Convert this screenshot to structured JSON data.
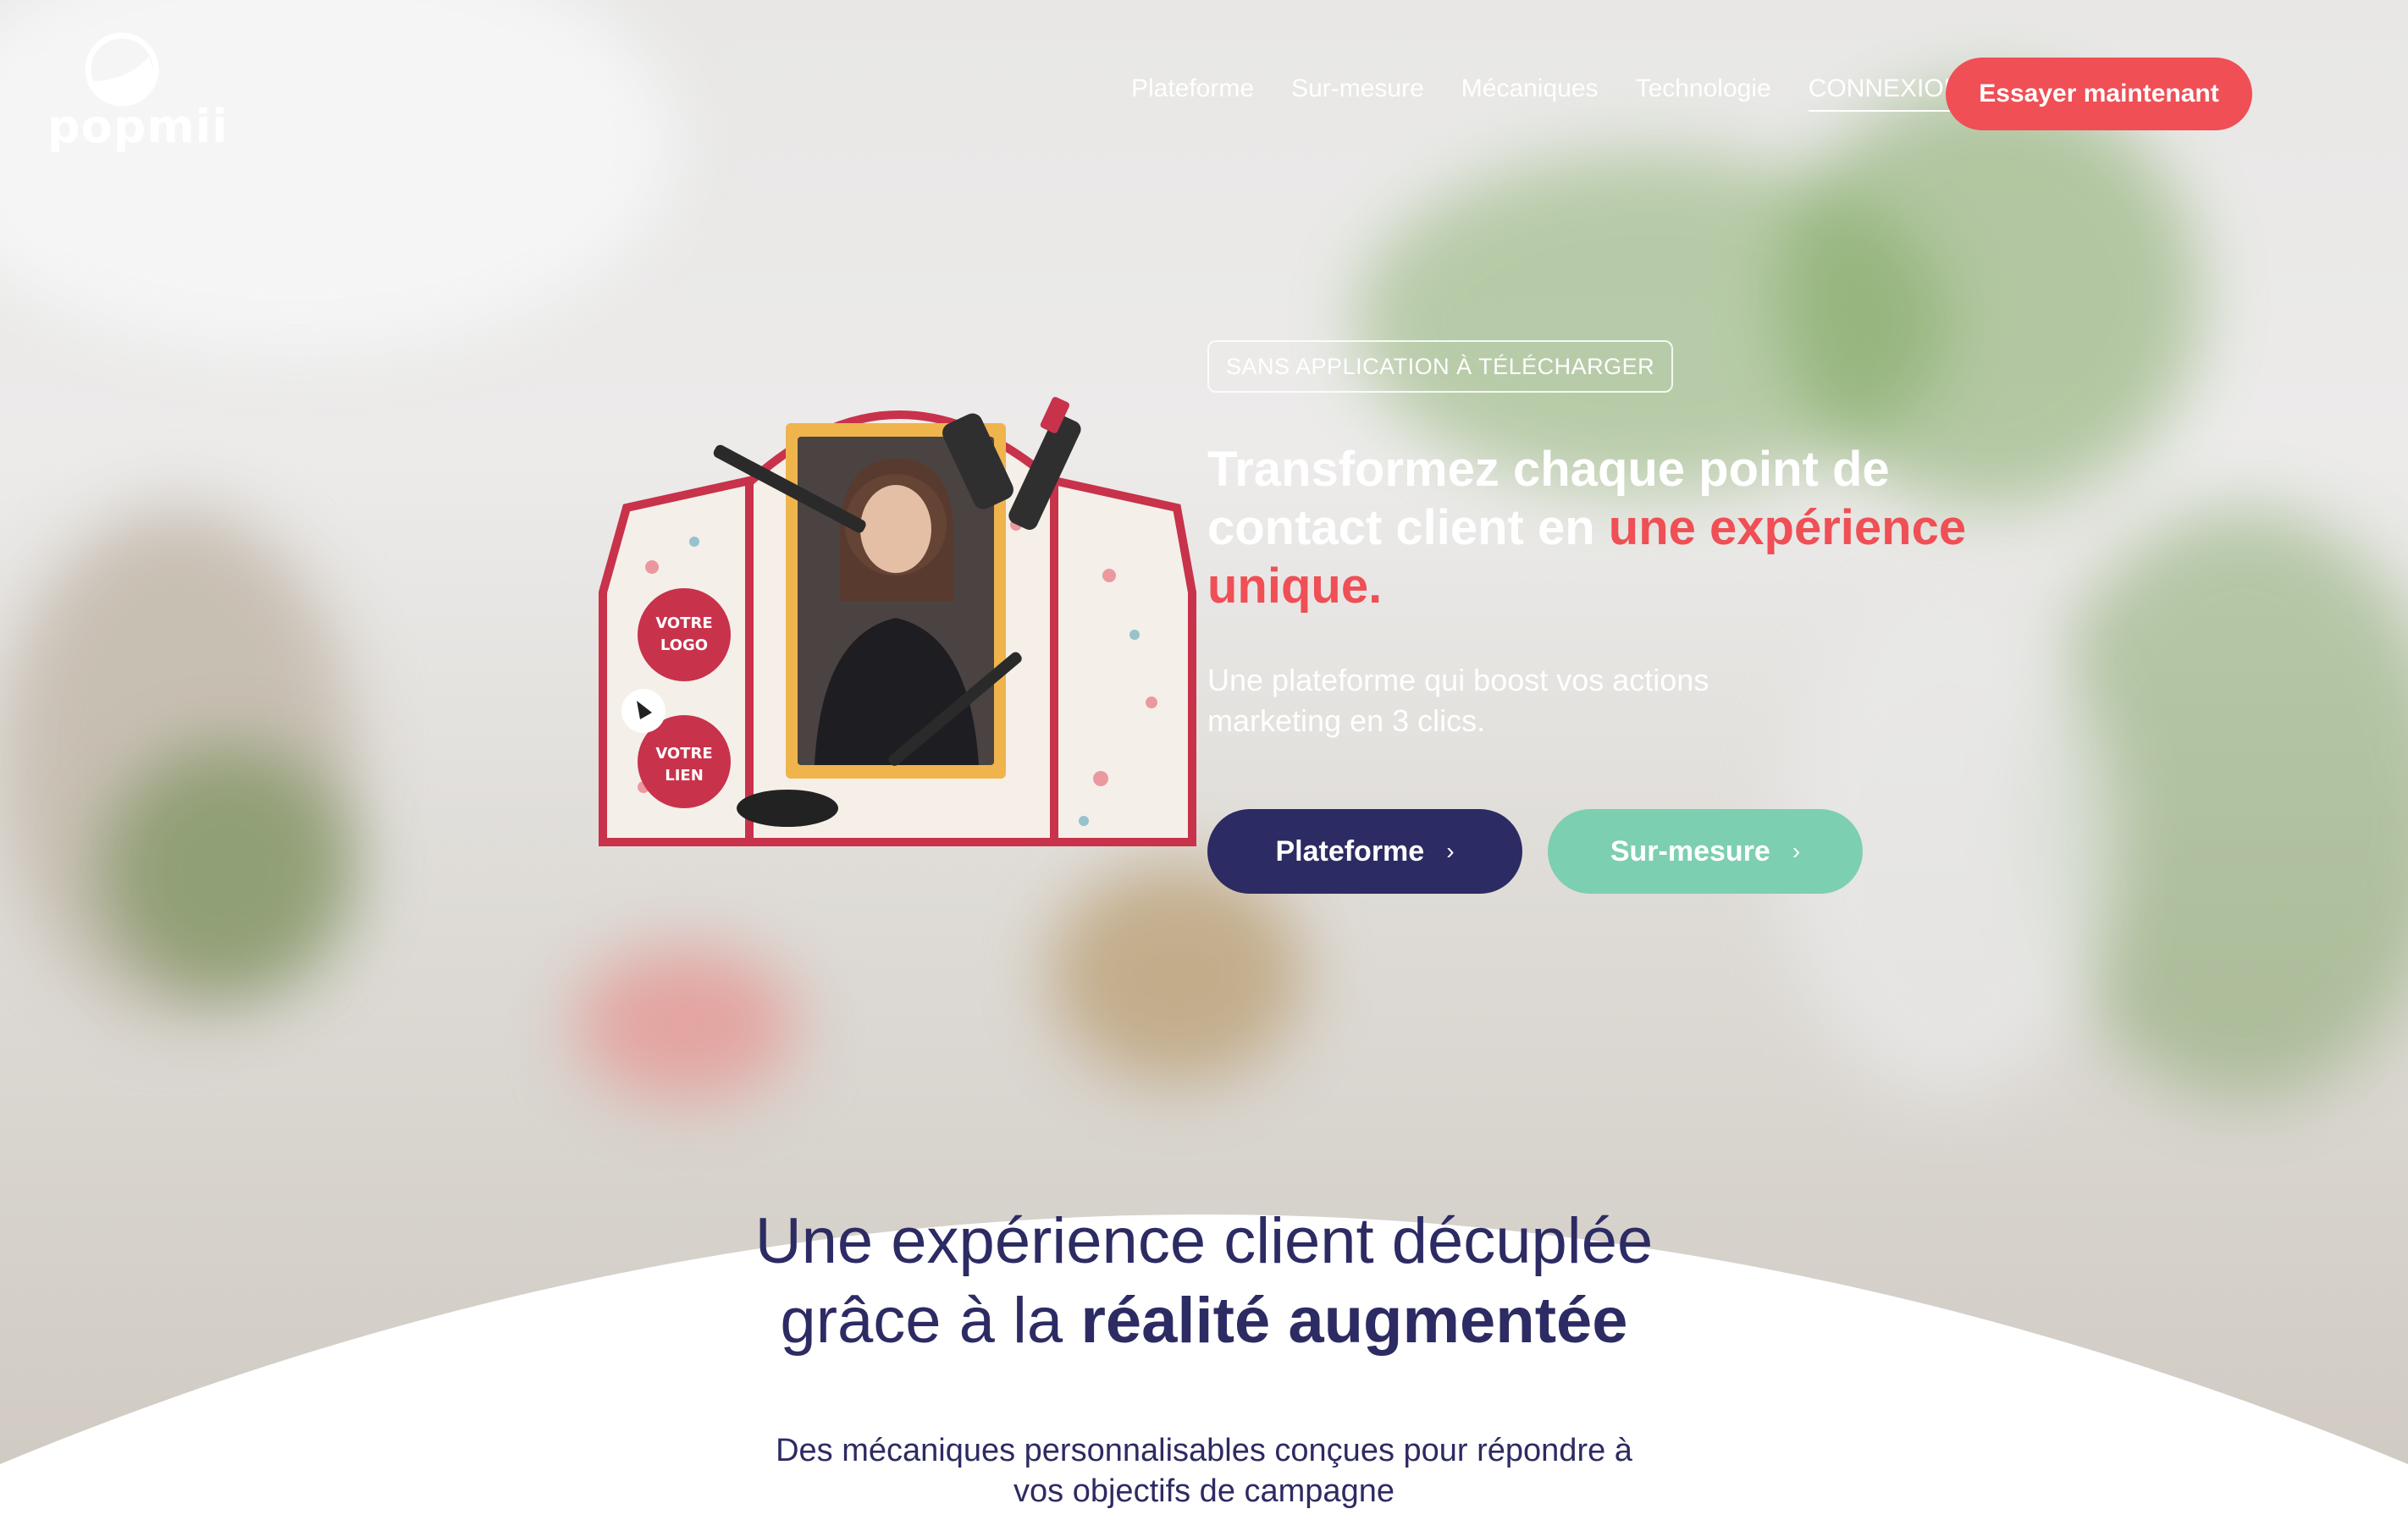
{
  "brand": {
    "name": "popmii"
  },
  "nav": {
    "items": [
      "Plateforme",
      "Sur-mesure",
      "Mécaniques",
      "Technologie"
    ],
    "login": "CONNEXION",
    "cta": "Essayer maintenant"
  },
  "hero": {
    "badge": "SANS APPLICATION À TÉLÉCHARGER",
    "title_part1": "Transformez chaque point de contact client en ",
    "title_accent": "une expérience unique.",
    "subtitle": "Une plateforme qui boost vos actions marketing en 3 clics.",
    "buttons": [
      {
        "label": "Plateforme",
        "chevron": "›"
      },
      {
        "label": "Sur-mesure",
        "chevron": "›"
      }
    ],
    "ar_card": {
      "label_logo": "VOTRE LOGO",
      "label_link": "VOTRE LIEN",
      "clic_label": "Clic"
    }
  },
  "section": {
    "title_line1": "Une expérience client décuplée",
    "title_line2_prefix": "grâce à la ",
    "title_line2_bold": "réalité augmentée",
    "description": "Des mécaniques personnalisables conçues pour répondre à vos objectifs de campagne"
  },
  "colors": {
    "accent": "#ef4f55",
    "navy": "#2d2b63",
    "mint": "#7dcfb1"
  }
}
